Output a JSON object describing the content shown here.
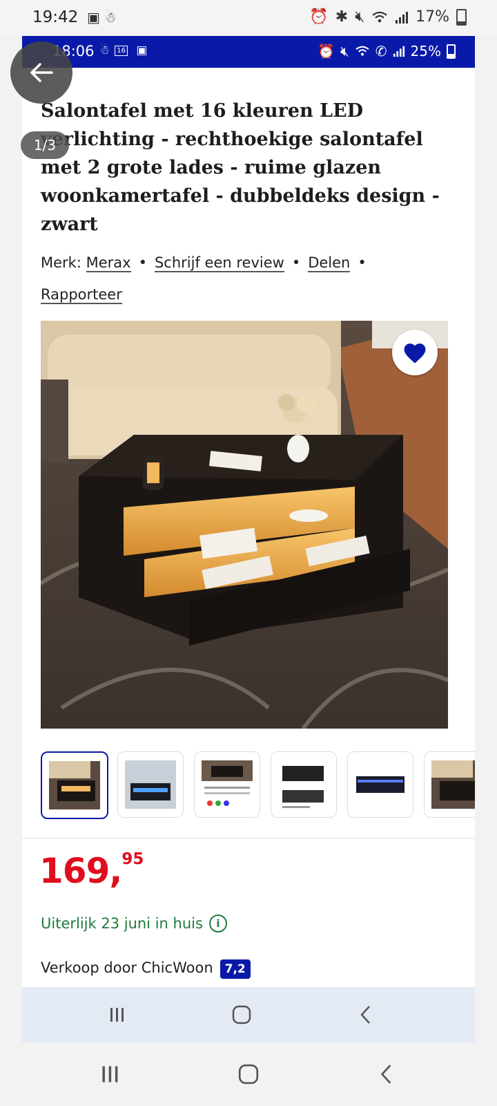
{
  "device_status": {
    "time": "19:42",
    "left_icons": [
      "image-icon",
      "notification-icon"
    ],
    "right_icons": [
      "alarm-icon",
      "bluetooth-icon",
      "mute-icon",
      "wifi-icon",
      "signal-icon"
    ],
    "battery": "17%",
    "battery_level": 0.17
  },
  "screenshot_status": {
    "time": "18:06",
    "icons": [
      "notification-icon",
      "calendar-icon",
      "image-icon"
    ],
    "calendar_day": "16",
    "right_icons": [
      "alarm-icon",
      "mute-icon",
      "wifi-icon",
      "wifi-call-icon",
      "signal-icon"
    ],
    "battery": "25%",
    "battery_level": 0.25,
    "bar_color": "#0a1aa8"
  },
  "viewer": {
    "back_icon": "arrow-left-icon",
    "image_counter": "1/3"
  },
  "product": {
    "title": "Salontafel met 16 kleuren LED verlichting - rechthoekige salontafel met 2 grote lades - ruime glazen woonkamertafel - dubbeldeks design - zwart",
    "brand_prefix": "Merk:",
    "brand": "Merax",
    "review_link": "Schrijf een review",
    "share_link": "Delen",
    "report_link": "Rapporteer",
    "separator": "•",
    "favorite_icon": "heart-icon",
    "thumbnail_count": 6,
    "selected_thumbnail": 1,
    "price_whole": "169,",
    "price_cents": "95",
    "delivery": "Uiterlijk 23 juni in huis",
    "seller_text": "Verkoop door ChicWoon",
    "seller_rating": "7,2",
    "colors": {
      "price": "#e00d1d",
      "delivery": "#1f7a3c",
      "accent": "#0a1aa8"
    }
  },
  "inner_nav": [
    "recents-icon",
    "home-icon",
    "back-icon"
  ],
  "outer_nav": [
    "recents-icon",
    "home-icon",
    "back-icon"
  ]
}
